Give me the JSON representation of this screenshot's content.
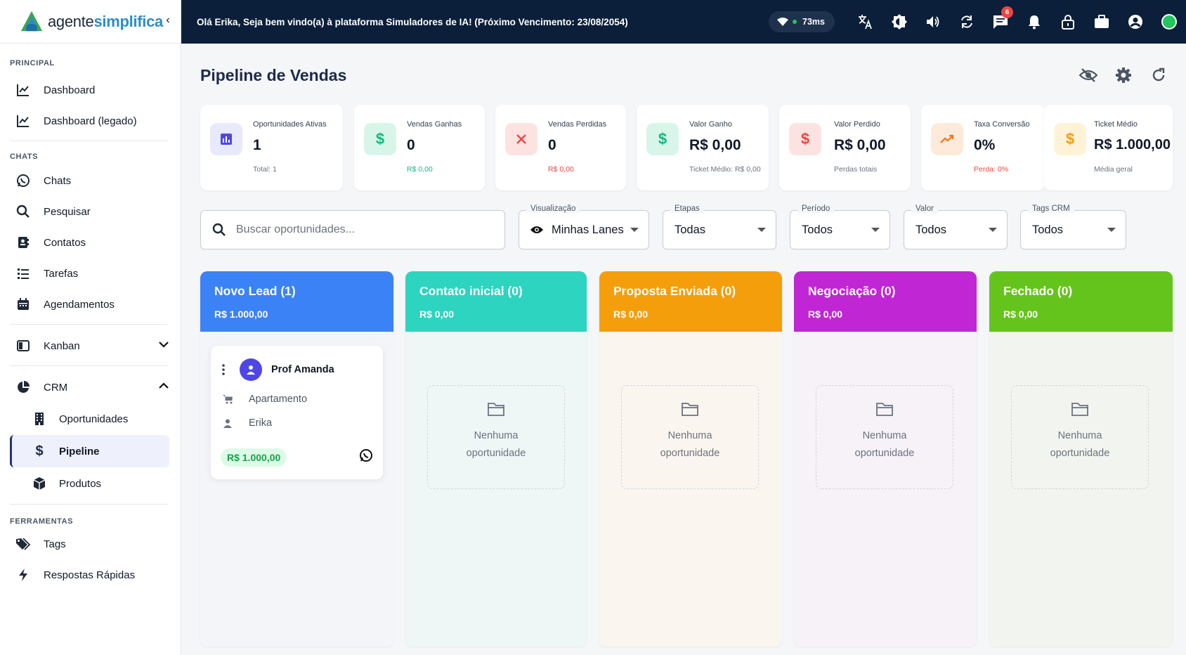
{
  "brand": {
    "name_part1": "agente",
    "name_part2": "simplifica"
  },
  "sidebar": {
    "sections": {
      "principal": "PRINCIPAL",
      "chats": "CHATS",
      "ferramentas": "FERRAMENTAS"
    },
    "items": {
      "dashboard": "Dashboard",
      "dashboard_legado": "Dashboard (legado)",
      "chats": "Chats",
      "pesquisar": "Pesquisar",
      "contatos": "Contatos",
      "tarefas": "Tarefas",
      "agendamentos": "Agendamentos",
      "kanban": "Kanban",
      "crm": "CRM",
      "oportunidades": "Oportunidades",
      "pipeline": "Pipeline",
      "produtos": "Produtos",
      "tags": "Tags",
      "respostas_rapidas": "Respostas Rápidas"
    }
  },
  "topbar": {
    "welcome": "Olá Erika, Seja bem vindo(a) à plataforma Simuladores de IA! (Próximo Vencimento: 23/08/2054)",
    "latency": "73ms",
    "messages_badge": "6",
    "status_color": "#22c55e"
  },
  "page": {
    "title": "Pipeline de Vendas"
  },
  "kpis": [
    {
      "label": "Oportunidades Ativas",
      "value": "1",
      "sub": "Total: 1",
      "icon": "bar-chart-icon",
      "color": "#4f46e5"
    },
    {
      "label": "Vendas Ganhas",
      "value": "0",
      "sub": "R$ 0,00",
      "icon": "dollar-icon",
      "color": "#10b981"
    },
    {
      "label": "Vendas Perdidas",
      "value": "0",
      "sub": "R$ 0,00",
      "icon": "close-icon",
      "color": "#ef4444"
    },
    {
      "label": "Valor Ganho",
      "value": "R$ 0,00",
      "sub": "Ticket Médio: R$ 0,00",
      "icon": "dollar-icon",
      "color": "#10b981"
    },
    {
      "label": "Valor Perdido",
      "value": "R$ 0,00",
      "sub": "Perdas totais",
      "icon": "dollar-icon",
      "color": "#ef4444"
    },
    {
      "label": "Taxa Conversão",
      "value": "0%",
      "sub": "Perda: 0%",
      "icon": "trending-up-icon",
      "color": "#f97316"
    },
    {
      "label": "Ticket Médio",
      "value": "R$ 1.000,00",
      "sub": "Média geral",
      "icon": "dollar-icon",
      "color": "#f59e0b"
    }
  ],
  "filters": {
    "search_placeholder": "Buscar oportunidades...",
    "search_value": "",
    "visualizacao": {
      "label": "Visualização",
      "value": "Minhas Lanes"
    },
    "etapas": {
      "label": "Etapas",
      "value": "Todas"
    },
    "periodo": {
      "label": "Período",
      "value": "Todos"
    },
    "valor": {
      "label": "Valor",
      "value": "Todos"
    },
    "tags": {
      "label": "Tags CRM",
      "value": "Todos"
    }
  },
  "lanes": [
    {
      "title": "Novo Lead (1)",
      "total": "R$ 1.000,00",
      "color": "#3b82f6"
    },
    {
      "title": "Contato inicial (0)",
      "total": "R$ 0,00",
      "color": "#2dd4bf",
      "empty": "Nenhuma oportunidade"
    },
    {
      "title": "Proposta Enviada (0)",
      "total": "R$ 0,00",
      "color": "#f59e0b",
      "empty": "Nenhuma oportunidade"
    },
    {
      "title": "Negociação (0)",
      "total": "R$ 0,00",
      "color": "#c026d3",
      "empty": "Nenhuma oportunidade"
    },
    {
      "title": "Fechado (0)",
      "total": "R$ 0,00",
      "color": "#65c41b",
      "empty": "Nenhuma oportunidade"
    }
  ],
  "card": {
    "name": "Prof Amanda",
    "product": "Apartamento",
    "owner": "Erika",
    "value": "R$ 1.000,00"
  }
}
